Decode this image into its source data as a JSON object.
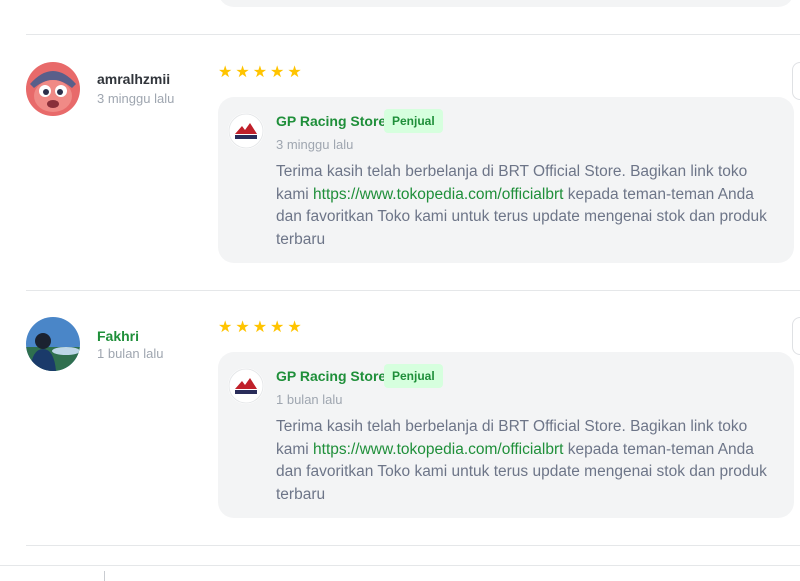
{
  "reviews": [
    {
      "username": "amralhzmii",
      "time": "3 minggu lalu",
      "rating": 5,
      "avatar_icon": "cartoon-avatar-icon",
      "reply": {
        "store_name": "GP Racing Store",
        "badge": "Penjual",
        "time": "3 minggu lalu",
        "text_before": "Terima kasih telah berbelanja di BRT Official Store. Bagikan link toko kami ",
        "link": "https://www.tokopedia.com/officialbrt",
        "text_after": " kepada teman-teman Anda dan favoritkan Toko kami untuk terus update mengenai stok dan produk terbaru"
      }
    },
    {
      "username": "Fakhri",
      "time": "1 bulan lalu",
      "rating": 5,
      "avatar_icon": "photo-avatar-icon",
      "reply": {
        "store_name": "GP Racing Store",
        "badge": "Penjual",
        "time": "1 bulan lalu",
        "text_before": "Terima kasih telah berbelanja di BRT Official Store. Bagikan link toko kami ",
        "link": "https://www.tokopedia.com/officialbrt",
        "text_after": " kepada teman-teman Anda dan favoritkan Toko kami untuk terus update mengenai stok dan produk terbaru"
      }
    }
  ],
  "colors": {
    "star": "#ffc400",
    "brand_green": "#1f8f3a",
    "badge_bg": "#d6ffde",
    "reply_bg": "#f3f4f5"
  }
}
